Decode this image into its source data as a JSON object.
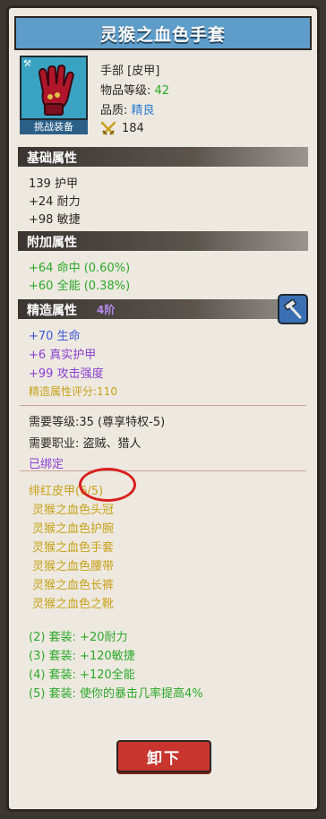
{
  "item": {
    "title": "灵猴之血色手套",
    "slot": "手部 [皮甲]",
    "level_label": "物品等级:",
    "level_value": "42",
    "quality_label": "品质:",
    "quality_value": "精良",
    "score": "184",
    "challenge_label": "挑战装备"
  },
  "base": {
    "header": "基础属性",
    "lines": [
      "139 护甲",
      "+24 耐力",
      "+98 敏捷"
    ]
  },
  "extra": {
    "header": "附加属性",
    "lines": [
      "+64 命中 (0.60%)",
      "+60 全能 (0.38%)"
    ]
  },
  "refine": {
    "header": "精造属性",
    "tier": "4阶",
    "lines": [
      "+70 生命",
      "+6 真实护甲",
      "+99 攻击强度"
    ],
    "score": "精造属性评分:110"
  },
  "requirements": {
    "level": "需要等级:35 (尊享特权-5)",
    "class": "需要职业: 盗贼、猎人",
    "bound": "已绑定"
  },
  "set": {
    "name": "绯红皮甲",
    "count": "(6/5)",
    "items": [
      "灵猴之血色头冠",
      "灵猴之血色护腕",
      "灵猴之血色手套",
      "灵猴之血色腰带",
      "灵猴之血色长裤",
      "灵猴之血色之靴"
    ],
    "bonuses": [
      "(2) 套装: +20耐力",
      "(3) 套装: +120敏捷",
      "(4) 套装: +120全能",
      "(5) 套装: 使你的暴击几率提高4%"
    ]
  },
  "actions": {
    "unequip": "卸下"
  },
  "colors": {
    "title_bar": "#5e9cc9",
    "green": "#2da82a",
    "purple": "#8a3ed1",
    "yellow": "#c7a11a",
    "button": "#c8352e"
  },
  "icons": [
    "glove-icon",
    "crossed-swords-icon",
    "hammer-icon"
  ]
}
